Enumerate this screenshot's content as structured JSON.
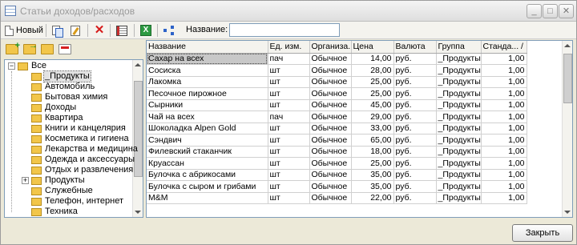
{
  "window": {
    "title": "Статьи доходов/расходов",
    "min": "_",
    "max": "□",
    "close": "✕"
  },
  "toolbar": {
    "new_label": "Новый",
    "name_label": "Название:",
    "name_value": "",
    "excel_glyph": "X",
    "delete_glyph": "✕"
  },
  "tree": {
    "expand_glyph": "−",
    "collapsed_glyph": "+",
    "root": "Все",
    "items": [
      "_Продукты",
      "Автомобиль",
      "Бытовая химия",
      "Доходы",
      "Квартира",
      "Книги и канцелярия",
      "Косметика и гигиена",
      "Лекарства и медицина",
      "Одежда и аксессуары",
      "Отдых и развлечения",
      "Продукты",
      "Служебные",
      "Телефон, интернет",
      "Техника"
    ]
  },
  "grid": {
    "columns": [
      "Название",
      "Ед. изм.",
      "Организа...",
      "Цена",
      "Валюта",
      "Группа",
      "Станда... /"
    ],
    "rows": [
      [
        "Сахар на всех",
        "пач",
        "Обычное",
        "14,00",
        "руб.",
        "_Продукты",
        "1,00"
      ],
      [
        "Сосиска",
        "шт",
        "Обычное",
        "28,00",
        "руб.",
        "_Продукты",
        "1,00"
      ],
      [
        "Лакомка",
        "шт",
        "Обычное",
        "25,00",
        "руб.",
        "_Продукты",
        "1,00"
      ],
      [
        "Песочное пирожное",
        "шт",
        "Обычное",
        "25,00",
        "руб.",
        "_Продукты",
        "1,00"
      ],
      [
        "Сырники",
        "шт",
        "Обычное",
        "45,00",
        "руб.",
        "_Продукты",
        "1,00"
      ],
      [
        "Чай на всех",
        "пач",
        "Обычное",
        "29,00",
        "руб.",
        "_Продукты",
        "1,00"
      ],
      [
        "Шоколадка Alpen Gold",
        "шт",
        "Обычное",
        "33,00",
        "руб.",
        "_Продукты",
        "1,00"
      ],
      [
        "Сэндвич",
        "шт",
        "Обычное",
        "65,00",
        "руб.",
        "_Продукты",
        "1,00"
      ],
      [
        "Филевский стаканчик",
        "шт",
        "Обычное",
        "18,00",
        "руб.",
        "_Продукты",
        "1,00"
      ],
      [
        "Круассан",
        "шт",
        "Обычное",
        "25,00",
        "руб.",
        "_Продукты",
        "1,00"
      ],
      [
        "Булочка с абрикосами",
        "шт",
        "Обычное",
        "35,00",
        "руб.",
        "_Продукты",
        "1,00"
      ],
      [
        "Булочка с сыром и грибами",
        "шт",
        "Обычное",
        "35,00",
        "руб.",
        "_Продукты",
        "1,00"
      ],
      [
        "M&M",
        "шт",
        "Обычное",
        "22,00",
        "руб.",
        "_Продукты",
        "1,00"
      ]
    ]
  },
  "footer": {
    "close_label": "Закрыть"
  },
  "colors": {
    "accent": "#7f9db9",
    "folder": "#f2c64a",
    "selection": "#c8c8c8"
  }
}
